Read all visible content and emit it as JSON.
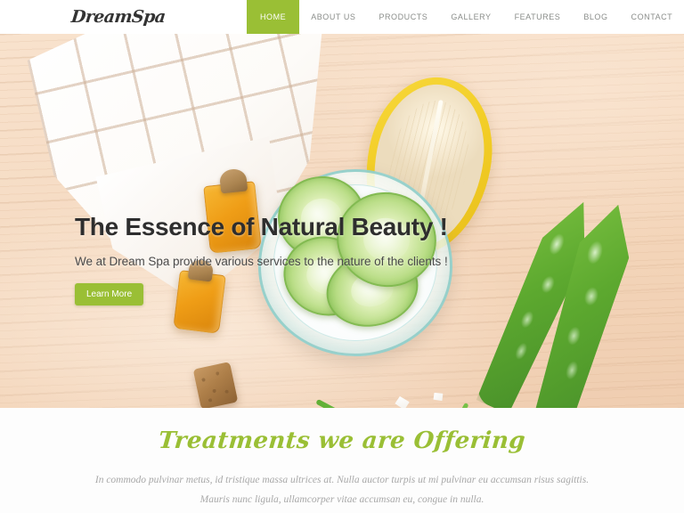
{
  "navbar": {
    "logo": "DreamSpa",
    "items": [
      {
        "label": "HOME",
        "active": true
      },
      {
        "label": "ABOUT US",
        "active": false
      },
      {
        "label": "PRODUCTS",
        "active": false
      },
      {
        "label": "GALLERY",
        "active": false
      },
      {
        "label": "FEATURES",
        "active": false
      },
      {
        "label": "BLOG",
        "active": false
      },
      {
        "label": "CONTACT",
        "active": false
      }
    ]
  },
  "hero": {
    "title": "The Essence of Natural Beauty !",
    "subtitle": "We at Dream Spa provide various services to the nature of the clients !",
    "button_label": "Learn More",
    "image_alt": "spa-flatlay-photo"
  },
  "treatments": {
    "heading": "Treatments we are Offering",
    "description": "In commodo pulvinar metus, id tristique massa ultrices at. Nulla auctor turpis ut mi pulvinar eu accumsan risus sagittis. Mauris nunc ligula, ullamcorper vitae accumsan eu, congue in nulla."
  },
  "colors": {
    "accent_green": "#9ABF35",
    "nav_text": "#8a8d8a",
    "heading_dark": "#2e2e2e",
    "body_gray": "#a8a8a8",
    "wood_background": "#F5D9C3"
  }
}
